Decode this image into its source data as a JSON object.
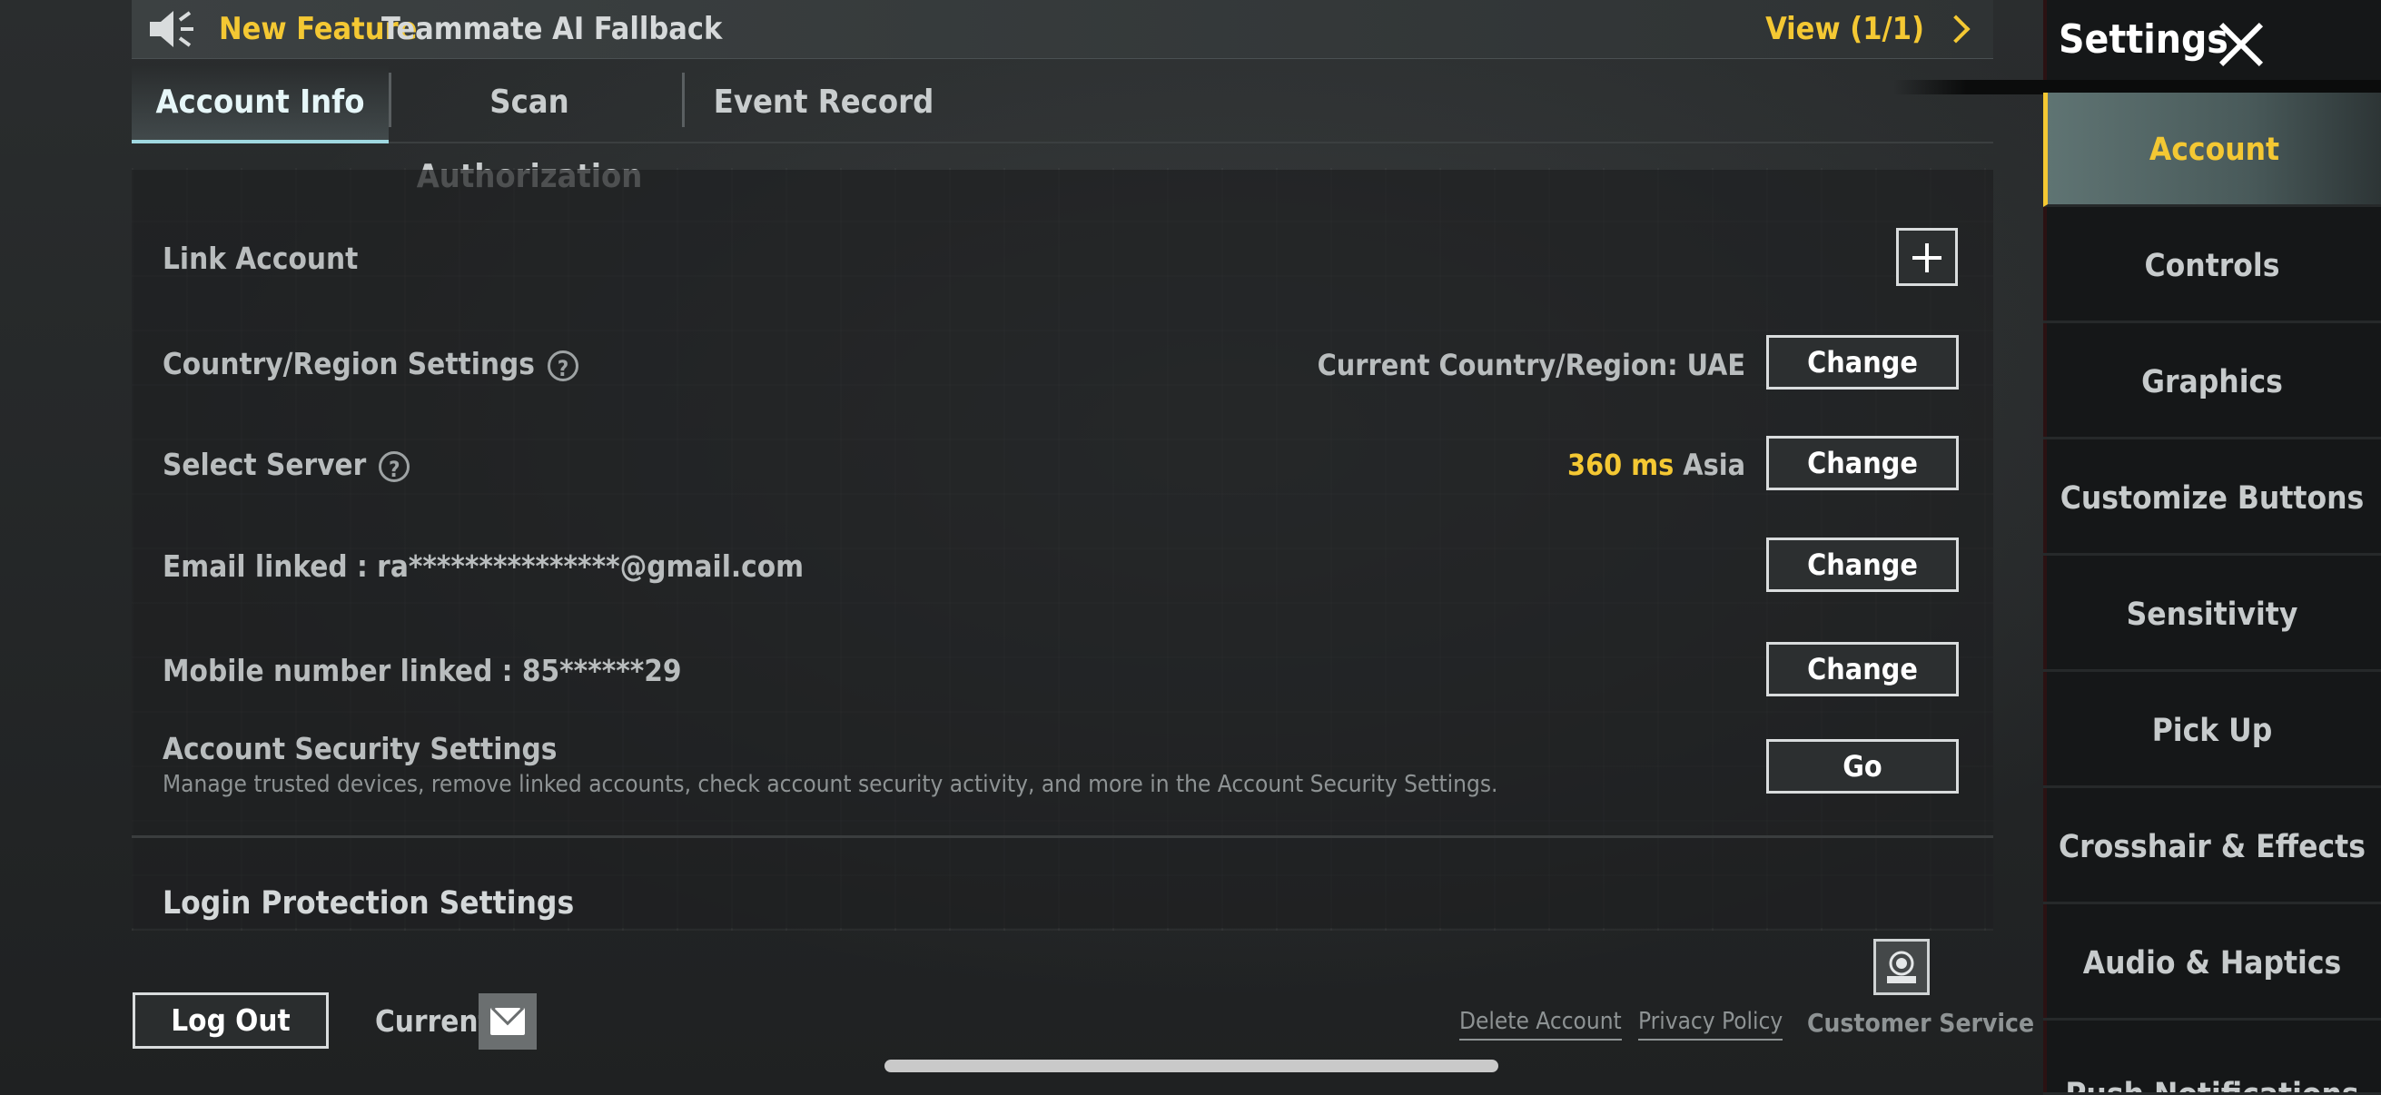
{
  "banner": {
    "new_feature": "New Feature",
    "feature_name": "Teammate AI Fallback",
    "view": "View (1/1)"
  },
  "tabs": [
    {
      "label": "Account Info",
      "active": true
    },
    {
      "label": "Scan Authorization",
      "active": false
    },
    {
      "label": "Event Record",
      "active": false
    }
  ],
  "account": {
    "link_account": "Link Account",
    "region_label": "Country/Region Settings",
    "region_value": "Current Country/Region: UAE",
    "server_label": "Select Server",
    "server_ms": "360 ms",
    "server_region": "Asia",
    "email_label": "Email linked : ra***************@gmail.com",
    "mobile_label": "Mobile number linked : 85******29",
    "security_label": "Account Security Settings",
    "security_desc": "Manage trusted devices, remove linked accounts, check account security activity, and more in the Account Security Settings.",
    "change": "Change",
    "go": "Go",
    "login_protection": "Login Protection Settings"
  },
  "footer": {
    "logout": "Log Out",
    "current": "Current",
    "delete_account": "Delete Account",
    "privacy_policy": "Privacy Policy",
    "customer_service": "Customer Service"
  },
  "sidebar": {
    "title": "Settings",
    "items": [
      {
        "label": "Account",
        "active": true
      },
      {
        "label": "Controls"
      },
      {
        "label": "Graphics"
      },
      {
        "label": "Customize Buttons"
      },
      {
        "label": "Sensitivity"
      },
      {
        "label": "Pick Up"
      },
      {
        "label": "Crosshair & Effects"
      },
      {
        "label": "Audio & Haptics"
      },
      {
        "label": "Push Notifications"
      }
    ]
  },
  "colors": {
    "accent_yellow": "#f4c833",
    "tab_active": "#9fd8e0"
  }
}
